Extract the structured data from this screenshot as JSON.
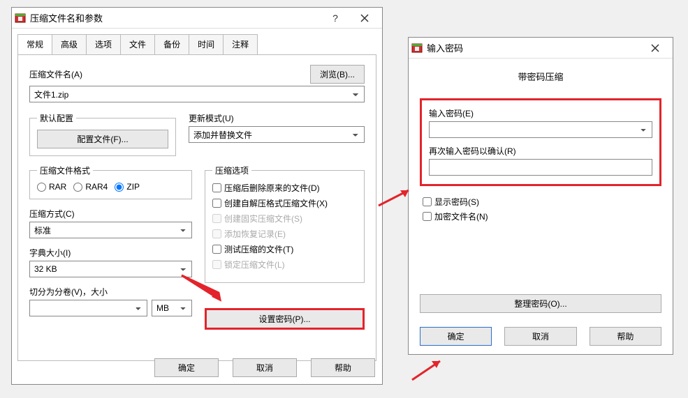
{
  "main_window": {
    "title": "压缩文件名和参数",
    "tabs": [
      "常规",
      "高级",
      "选项",
      "文件",
      "备份",
      "时间",
      "注释"
    ],
    "archive_name_label": "压缩文件名(A)",
    "browse_btn": "浏览(B)...",
    "archive_name_value": "文件1.zip",
    "default_profile_legend": "默认配置",
    "profile_btn": "配置文件(F)...",
    "update_mode_label": "更新模式(U)",
    "update_mode_value": "添加并替换文件",
    "archive_format_legend": "压缩文件格式",
    "format_options": {
      "rar": "RAR",
      "rar4": "RAR4",
      "zip": "ZIP"
    },
    "compression_method_label": "压缩方式(C)",
    "compression_method_value": "标准",
    "dict_size_label": "字典大小(I)",
    "dict_size_value": "32 KB",
    "split_label": "切分为分卷(V)，大小",
    "split_unit": "MB",
    "archiving_options_legend": "压缩选项",
    "opts": {
      "delete_after": "压缩后删除原来的文件(D)",
      "sfx": "创建自解压格式压缩文件(X)",
      "solid": "创建固实压缩文件(S)",
      "recovery": "添加恢复记录(E)",
      "test": "测试压缩的文件(T)",
      "lock": "锁定压缩文件(L)"
    },
    "set_password_btn": "设置密码(P)...",
    "ok": "确定",
    "cancel": "取消",
    "help": "帮助"
  },
  "pwd_window": {
    "title": "输入密码",
    "subtitle": "带密码压缩",
    "enter_label": "输入密码(E)",
    "reenter_label": "再次输入密码以确认(R)",
    "show_password": "显示密码(S)",
    "encrypt_names": "加密文件名(N)",
    "organize_btn": "整理密码(O)...",
    "ok": "确定",
    "cancel": "取消",
    "help": "帮助"
  }
}
